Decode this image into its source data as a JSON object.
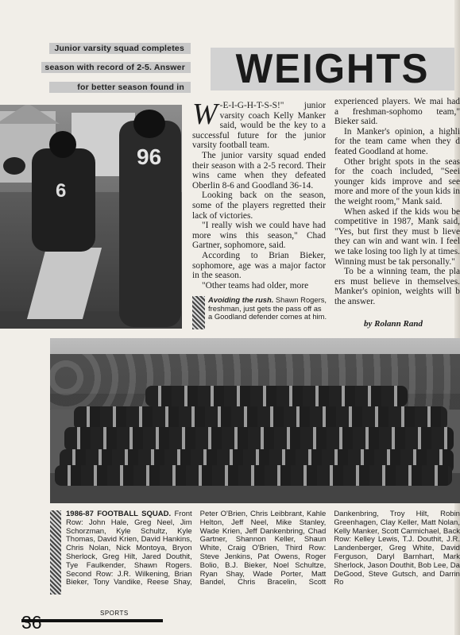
{
  "intro_lines": [
    "Junior varsity squad completes",
    "season with record of 2-5. Answer",
    "for better season found in"
  ],
  "title": "WEIGHTS",
  "photo1_numbers": [
    "6",
    "96"
  ],
  "article": {
    "dropcap": "W",
    "p1": "-E-I-G-H-T-S-S!\" junior varsity coach Kelly Manker said, would be the key to a successful future for the junior varsity football team.",
    "p2": "The junior varsity squad ended their season with a 2-5 record. Their wins came when they defeated Oberlin 8-6 and Goodland 36-14.",
    "p3": "Looking back on the season, some of the players regretted their lack of victories.",
    "p4": "\"I really wish we could have had more wins this season,\" Chad Gartner, sophomore, said.",
    "p5": "According to Brian Bieker, sophomore, age was a major factor in the season.",
    "p6": "\"Other teams had older, more",
    "c2p1": "experienced players. We mai had a freshman-sophomo team,\" Bieker said.",
    "c2p2": "In Manker's opinion, a highli for the team came when they d feated Goodland at home.",
    "c2p3": "Other bright spots in the seas for the coach included, \"Seei younger kids improve and see more and more of the youn kids in the weight room,\" Mank said.",
    "c2p4": "When asked if the kids wou be competitive in 1987, Mank said, \"Yes, but first they must b lieve they can win and want win. I feel we take losing too ligh ly at times. Winning must be tak personally.\"",
    "c2p5": "To be a winning team, the pla ers must believe in themselves. Manker's opinion, weights will b the answer."
  },
  "caption1": {
    "lead": "Avoiding the rush.",
    "text": " Shawn Rogers, freshman, just gets the pass off as a Goodland defender comes at him."
  },
  "byline": "by Rolann Rand",
  "roster": {
    "lead": "1986-87 FOOTBALL SQUAD.",
    "text": " Front Row: John Hale, Greg Neel, Jim Schorzman, Kyle Schultz, Kyle Thomas, David Krien, David Hankins, Chris Nolan, Nick Montoya, Bryon Sherlock, Greg Hilt, Jared Douthit, Tye Faulkender, Shawn Rogers. Second Row: J.R. Wilkening, Brian Bieker, Tony Vandike, Reese Shay, Peter O'Brien, Chris Leibbrant, Kahle Helton, Jeff Neel, Mike Stanley, Wade Krien, Jeff Dankenbring, Chad Gartner, Shannon Keller, Shaun White, Craig O'Brien, Third Row: Steve Jenkins, Pat Owens, Roger Bolio, B.J. Bieker, Noel Schultze, Ryan Shay, Wade Porter, Matt Bandel, Chris Bracelin, Scott Dankenbring, Troy Hilt, Robin Greenhagen, Clay Keller, Matt Nolan, Kelly Manker, Scott Carmichael, Back Row: Kelley Lewis, T.J. Douthit, J.R. Landenberger, Greg White, David Ferguson, Daryl Barnhart, Mark Sherlock, Jason Douthit, Bob Lee, Da DeGood, Steve Gutsch, and Darrin Ro"
  },
  "folio": {
    "number": "36",
    "label": "SPORTS"
  }
}
